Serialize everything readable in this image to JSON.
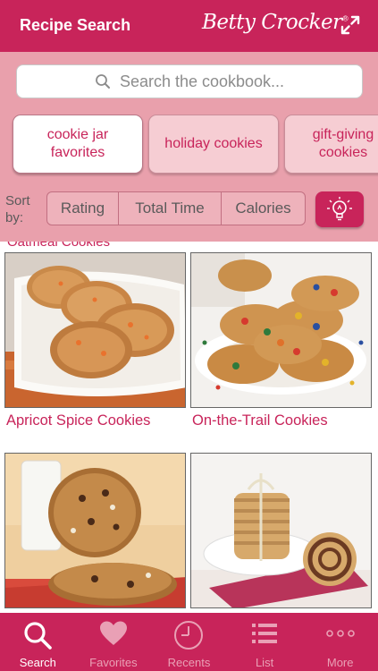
{
  "header": {
    "title": "Recipe Search",
    "brand": "Betty Crocker",
    "brand_mark": "®"
  },
  "search": {
    "placeholder": "Search the cookbook..."
  },
  "chips": [
    {
      "label": "cookie jar favorites",
      "active": true
    },
    {
      "label": "holiday cookies",
      "active": false
    },
    {
      "label": "gift-giving cookies",
      "active": false
    }
  ],
  "sort": {
    "label": "Sort by:",
    "options": [
      "Rating",
      "Total Time",
      "Calories"
    ]
  },
  "results": {
    "partial_title": "Oatmeal Cookies",
    "items": [
      {
        "title": "Apricot Spice Cookies",
        "image": "apricot-spice-cookies-photo"
      },
      {
        "title": "On-the-Trail Cookies",
        "image": "on-the-trail-cookies-photo"
      },
      {
        "title": "",
        "image": "chocolate-chip-cookies-photo"
      },
      {
        "title": "",
        "image": "pinwheel-cookies-photo"
      }
    ]
  },
  "tabs": [
    {
      "label": "Search",
      "icon": "search-icon",
      "active": true
    },
    {
      "label": "Favorites",
      "icon": "heart-icon",
      "active": false
    },
    {
      "label": "Recents",
      "icon": "clock-icon",
      "active": false
    },
    {
      "label": "List",
      "icon": "list-icon",
      "active": false
    },
    {
      "label": "More",
      "icon": "more-icon",
      "active": false
    }
  ],
  "colors": {
    "brand": "#c8245a",
    "panel": "#e9a0ac",
    "chip_inactive": "#f6cdd3"
  }
}
